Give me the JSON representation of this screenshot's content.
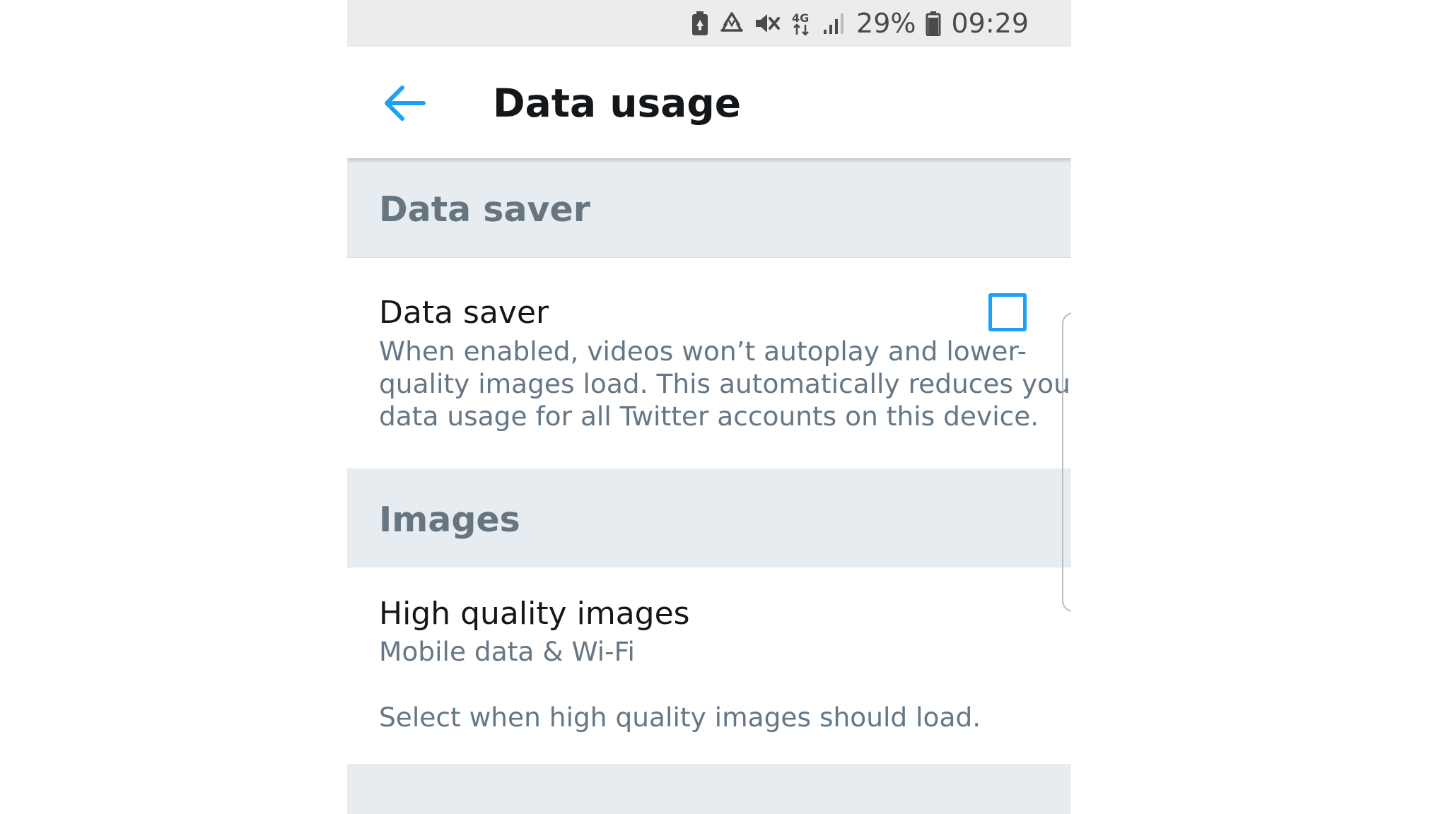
{
  "status_bar": {
    "battery_percent": "29%",
    "time": "09:29",
    "network": "4G",
    "icons": [
      "battery-saver-icon",
      "recycle-icon",
      "mute-icon",
      "network-4g-icon",
      "signal-icon",
      "battery-icon"
    ]
  },
  "toolbar": {
    "back_icon": "back-arrow-icon",
    "title": "Data usage"
  },
  "sections": {
    "data_saver": {
      "header": "Data saver",
      "row": {
        "title": "Data saver",
        "description_lines": [
          "When enabled, videos won’t autoplay and lower-",
          "quality images load. This automatically reduces your",
          "data usage for all Twitter accounts on this device."
        ],
        "checked": false
      }
    },
    "images": {
      "header": "Images",
      "row": {
        "title": "High quality images",
        "value": "Mobile data & Wi-Fi",
        "hint": "Select when high quality images should load."
      }
    }
  },
  "colors": {
    "accent": "#1da1f2",
    "section_bg": "#e6ecf0",
    "section_text": "#66757f",
    "primary_text": "#14171a",
    "secondary_text": "#657786",
    "status_bar_bg": "#ececec"
  }
}
